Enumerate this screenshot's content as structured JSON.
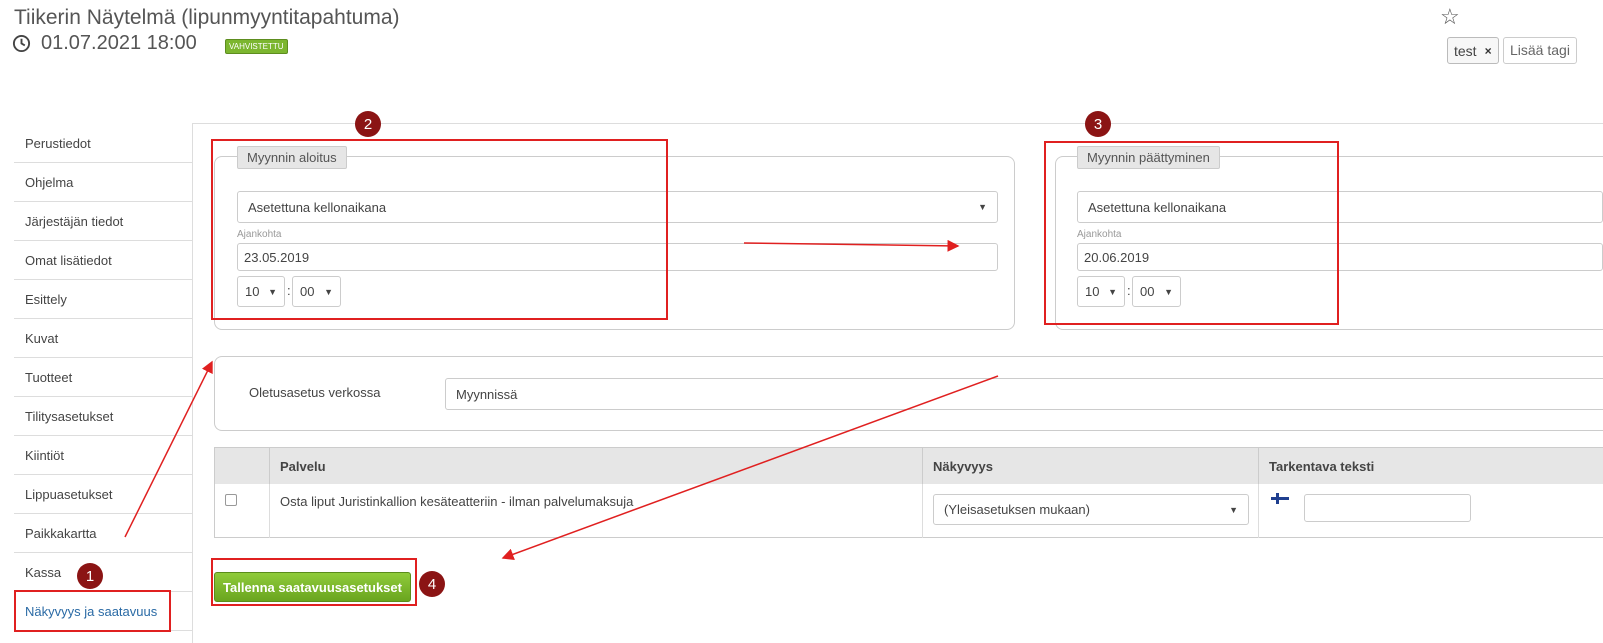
{
  "header": {
    "title": "Tiikerin Näytelmä (lipunmyyntitapahtuma)",
    "datetime": "01.07.2021 18:00",
    "status_badge": "VAHVISTETTU",
    "tags": [
      {
        "label": "test",
        "remove": "×"
      }
    ],
    "add_tag_label": "Lisää tagi",
    "favorite_icon": "star-icon"
  },
  "sidebar": {
    "items": [
      {
        "label": "Perustiedot"
      },
      {
        "label": "Ohjelma"
      },
      {
        "label": "Järjestäjän tiedot"
      },
      {
        "label": "Omat lisätiedot"
      },
      {
        "label": "Esittely"
      },
      {
        "label": "Kuvat"
      },
      {
        "label": "Tuotteet"
      },
      {
        "label": "Tilitysasetukset"
      },
      {
        "label": "Kiintiöt"
      },
      {
        "label": "Lippuasetukset"
      },
      {
        "label": "Paikkakartta"
      },
      {
        "label": "Kassa"
      },
      {
        "label": "Näkyvyys ja saatavuus",
        "active": true
      }
    ]
  },
  "sales_start": {
    "legend": "Myynnin aloitus",
    "mode": "Asetettuna kellonaikana",
    "date_label": "Ajankohta",
    "date": "23.05.2019",
    "hour": "10",
    "minute": "00",
    "separator": ":"
  },
  "sales_end": {
    "legend": "Myynnin päättyminen",
    "mode": "Asetettuna kellonaikana",
    "date_label": "Ajankohta",
    "date": "20.06.2019",
    "hour": "10",
    "minute": "00",
    "separator": ":"
  },
  "online_default": {
    "label": "Oletusasetus verkossa",
    "value": "Myynnissä"
  },
  "services_table": {
    "headers": {
      "service": "Palvelu",
      "visibility": "Näkyvyys",
      "extra_text": "Tarkentava teksti"
    },
    "rows": [
      {
        "service": "Osta liput Juristinkallion kesäteatteriin - ilman palvelumaksuja",
        "visibility": "(Yleisasetuksen mukaan)",
        "extra_text": "",
        "flag_icon": "finland-flag-icon"
      }
    ]
  },
  "save_button": "Tallenna saatavuusasetukset",
  "annotations": {
    "markers": [
      "1",
      "2",
      "3",
      "4"
    ],
    "color": "#e02020",
    "marker_color": "#8b1414"
  },
  "colors": {
    "accent_green": "#7cb62f",
    "active_link": "#2a6aa5"
  }
}
